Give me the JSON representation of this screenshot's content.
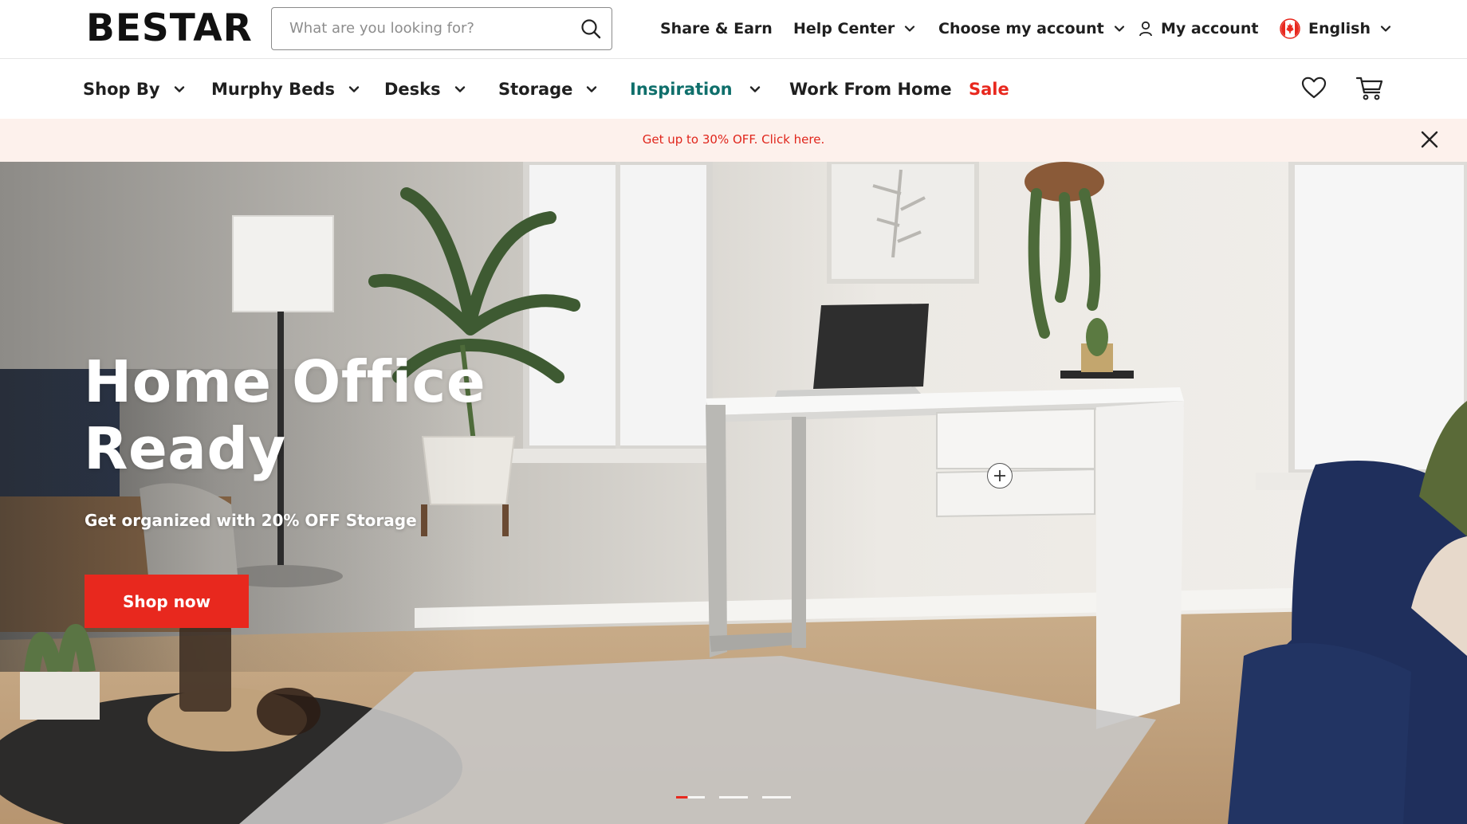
{
  "brand": {
    "logo_text": "BESTAR"
  },
  "search": {
    "placeholder": "What are you looking for?",
    "value": ""
  },
  "utility_nav": {
    "share_earn": "Share & Earn",
    "help_center": "Help Center",
    "choose_account": "Choose my account",
    "my_account": "My account",
    "language": "English"
  },
  "main_nav": {
    "items": [
      {
        "label": "Shop By"
      },
      {
        "label": "Murphy Beds"
      },
      {
        "label": "Desks"
      },
      {
        "label": "Storage"
      },
      {
        "label": "Inspiration"
      },
      {
        "label": "Work From Home"
      },
      {
        "label": "Sale"
      }
    ]
  },
  "promo": {
    "text": "Get up to 30% OFF. Click here."
  },
  "hero": {
    "title": "Home Office Ready",
    "subtitle": "Get organized with 20% OFF Storage",
    "cta": "Shop now",
    "slides_total": 3,
    "active_slide": 1
  },
  "colors": {
    "accent_red": "#e8281e",
    "inspiration_teal": "#0f6f6b",
    "promo_bg": "#fdf1ec"
  },
  "icons": [
    "search-icon",
    "chevron-down-icon",
    "user-icon",
    "canada-flag-icon",
    "heart-icon",
    "cart-icon",
    "close-icon",
    "plus-icon"
  ]
}
